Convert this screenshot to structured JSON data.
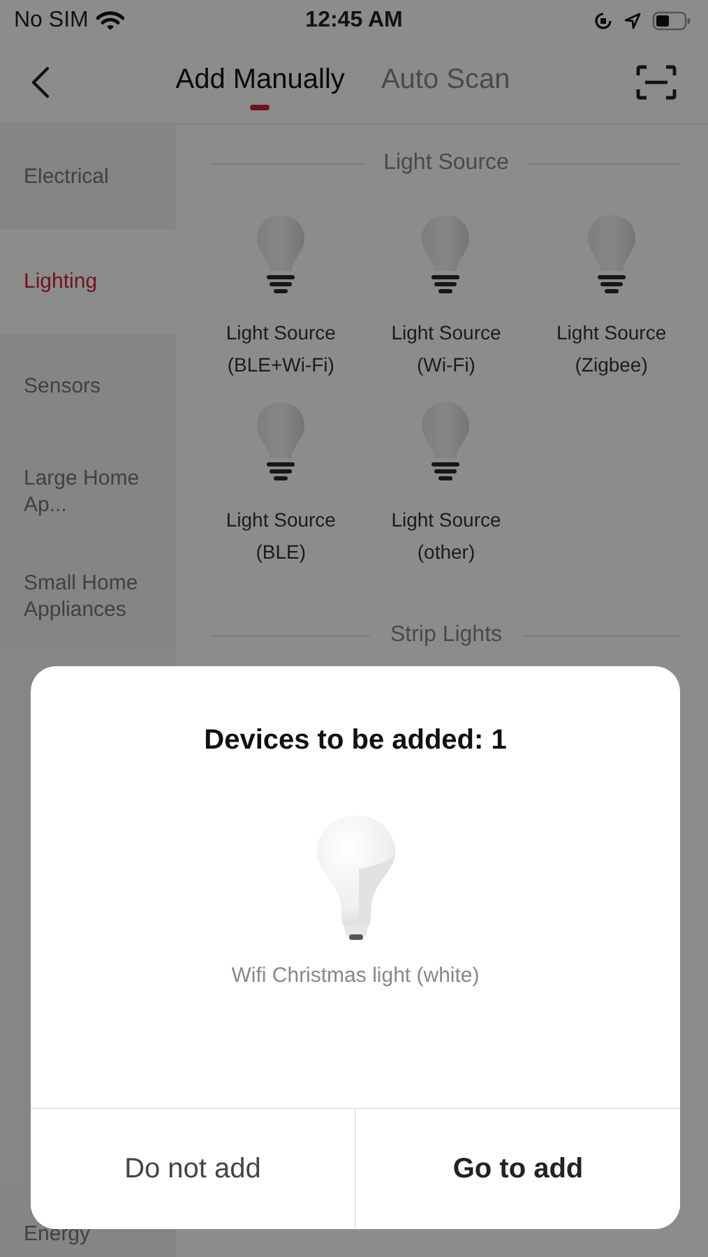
{
  "status_bar": {
    "carrier": "No SIM",
    "time": "12:45 AM"
  },
  "tabs": [
    {
      "label": "Add Manually",
      "selected": true
    },
    {
      "label": "Auto Scan",
      "selected": false
    }
  ],
  "categories": [
    {
      "label": "Electrical",
      "selected": false
    },
    {
      "label": "Lighting",
      "selected": true
    },
    {
      "label": "Sensors",
      "selected": false
    },
    {
      "label": "Large Home Ap...",
      "selected": false
    },
    {
      "label": "Small Home Appliances",
      "selected": false
    },
    {
      "label": "Energy",
      "selected": false
    }
  ],
  "sections": [
    {
      "title": "Light Source",
      "devices": [
        {
          "name": "Light Source",
          "protocol": "(BLE+Wi-Fi)"
        },
        {
          "name": "Light Source",
          "protocol": "(Wi-Fi)"
        },
        {
          "name": "Light Source",
          "protocol": "(Zigbee)"
        },
        {
          "name": "Light Source",
          "protocol": "(BLE)"
        },
        {
          "name": "Light Source",
          "protocol": "(other)"
        }
      ]
    },
    {
      "title": "Strip Lights"
    }
  ],
  "dialog": {
    "title": "Devices to be added: 1",
    "device": "Wifi Christmas light (white)",
    "buttons": [
      {
        "label": "Do not add",
        "kind": "secondary"
      },
      {
        "label": "Go to add",
        "kind": "primary"
      }
    ]
  }
}
